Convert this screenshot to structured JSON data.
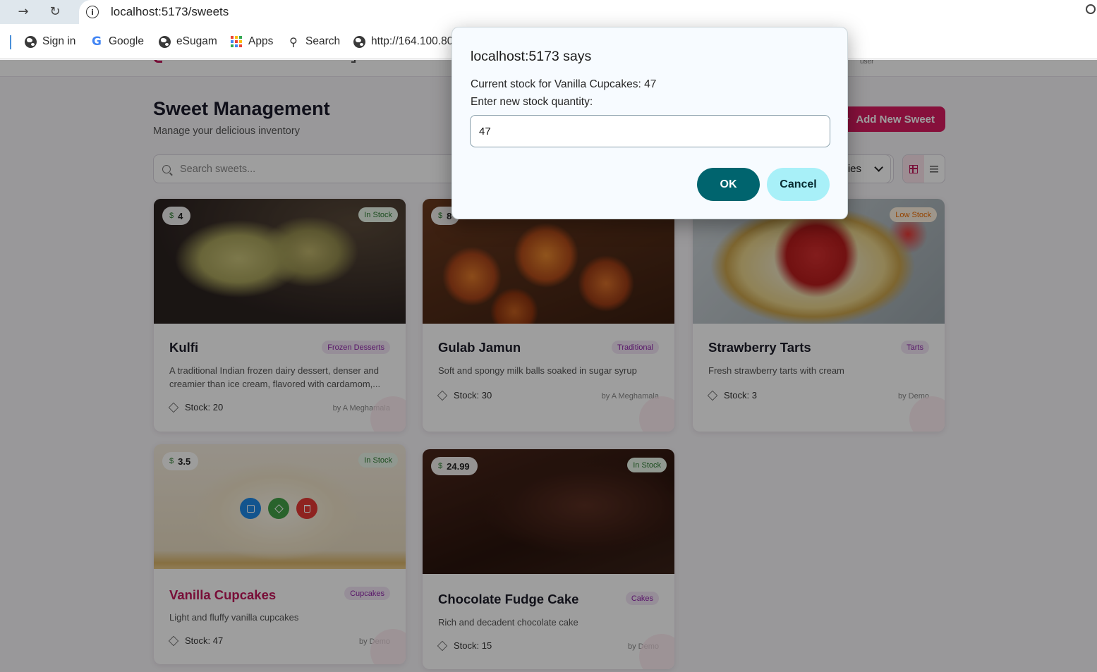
{
  "browser": {
    "url": "localhost:5173/sweets",
    "bookmarks": [
      {
        "label": "Sign in",
        "icon": "globe-icon"
      },
      {
        "label": "Google",
        "icon": "google-icon"
      },
      {
        "label": "eSugam",
        "icon": "globe-icon"
      },
      {
        "label": "Apps",
        "icon": "apps-grid-icon"
      },
      {
        "label": "Search",
        "icon": "search-icon"
      },
      {
        "label": "http://164.100.80",
        "icon": "globe-icon"
      }
    ]
  },
  "header": {
    "user_role": "user"
  },
  "page": {
    "title": "Sweet Management",
    "subtitle": "Manage your delicious inventory",
    "add_button": "Add New Sweet",
    "search_placeholder": "Search sweets...",
    "category_select_visible": "ies"
  },
  "cards": [
    {
      "price": "4",
      "stock_status": "In Stock",
      "name": "Kulfi",
      "category": "Frozen Desserts",
      "description": "A traditional Indian frozen dairy dessert, denser and creamier than ice cream, flavored with cardamom,...",
      "stock": "Stock: 20",
      "author": "by A Meghamala"
    },
    {
      "price": "8",
      "stock_status": "",
      "name": "Gulab Jamun",
      "category": "Traditional",
      "description": "Soft and spongy milk balls soaked in sugar syrup",
      "stock": "Stock: 30",
      "author": "by A Meghamala"
    },
    {
      "price": "",
      "stock_status": "Low Stock",
      "name": "Strawberry Tarts",
      "category": "Tarts",
      "description": "Fresh strawberry tarts with cream",
      "stock": "Stock: 3",
      "author": "by Demo"
    },
    {
      "price": "3.5",
      "stock_status": "In Stock",
      "name": "Vanilla Cupcakes",
      "category": "Cupcakes",
      "description": "Light and fluffy vanilla cupcakes",
      "stock": "Stock: 47",
      "author": "by Demo"
    },
    {
      "price": "24.99",
      "stock_status": "In Stock",
      "name": "Chocolate Fudge Cake",
      "category": "Cakes",
      "description": "Rich and decadent chocolate cake",
      "stock": "Stock: 15",
      "author": "by Demo"
    }
  ],
  "dialog": {
    "title": "localhost:5173 says",
    "message_line1": "Current stock for Vanilla Cupcakes: 47",
    "message_line2": "Enter new stock quantity:",
    "input_value": "47",
    "ok": "OK",
    "cancel": "Cancel"
  },
  "colors": {
    "accent": "#d81b60",
    "ok_button": "#00646e",
    "cancel_button": "#a8f0f8"
  }
}
